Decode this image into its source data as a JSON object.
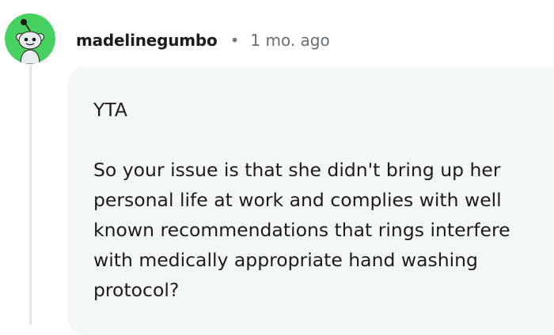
{
  "comment": {
    "author": "madelinegumbo",
    "separator": "•",
    "timestamp": "1 mo. ago",
    "avatar_icon": "snoo-avatar-icon",
    "paragraphs": [
      "YTA",
      "So your issue is that she didn't bring up her personal life at work and complies with well known recommendations that rings interfere with medically appropriate hand washing protocol?"
    ]
  },
  "colors": {
    "avatar_bg": "#46d160",
    "bubble_bg": "#f5f6f6",
    "text": "#1c1c1c",
    "meta": "#6a6d70"
  }
}
